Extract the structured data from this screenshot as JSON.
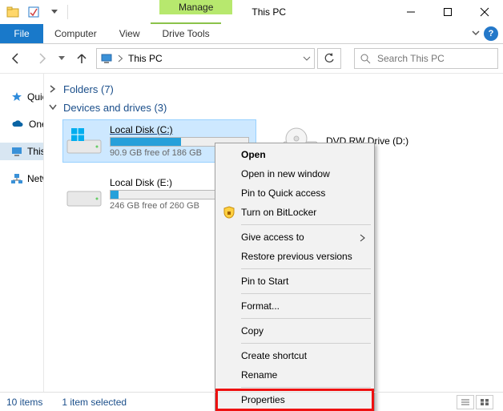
{
  "titlebar": {
    "manage": "Manage",
    "title": "This PC"
  },
  "ribbon": {
    "file": "File",
    "computer": "Computer",
    "view": "View",
    "drive_tools": "Drive Tools"
  },
  "addressbar": {
    "path": "This PC"
  },
  "search": {
    "placeholder": "Search This PC"
  },
  "sidebar": {
    "items": [
      {
        "label": "Quick access",
        "icon": "star",
        "color": "#2e8bdb"
      },
      {
        "label": "OneDrive",
        "icon": "cloud",
        "color": "#0a64a4"
      },
      {
        "label": "This PC",
        "icon": "pc",
        "color": "#2e8bdb",
        "selected": true
      },
      {
        "label": "Network",
        "icon": "network",
        "color": "#2e8bdb"
      }
    ]
  },
  "groups": {
    "folders": {
      "label": "Folders",
      "count": 7
    },
    "devices": {
      "label": "Devices and drives",
      "count": 3
    }
  },
  "drives": [
    {
      "name": "Local Disk (C:)",
      "fill_pct": 51,
      "free_text": "90.9 GB free of 186 GB",
      "icon": "os-drive",
      "selected": true
    },
    {
      "name": "DVD RW Drive (D:)",
      "icon": "dvd-drive"
    },
    {
      "name": "Local Disk (E:)",
      "fill_pct": 6,
      "free_text": "246 GB free of 260 GB",
      "icon": "drive"
    }
  ],
  "context_menu": {
    "open": "Open",
    "open_new": "Open in new window",
    "pin_quick": "Pin to Quick access",
    "bitlocker": "Turn on BitLocker",
    "give_access": "Give access to",
    "restore": "Restore previous versions",
    "pin_start": "Pin to Start",
    "format": "Format...",
    "copy": "Copy",
    "shortcut": "Create shortcut",
    "rename": "Rename",
    "properties": "Properties"
  },
  "statusbar": {
    "items": "10 items",
    "selected": "1 item selected"
  }
}
